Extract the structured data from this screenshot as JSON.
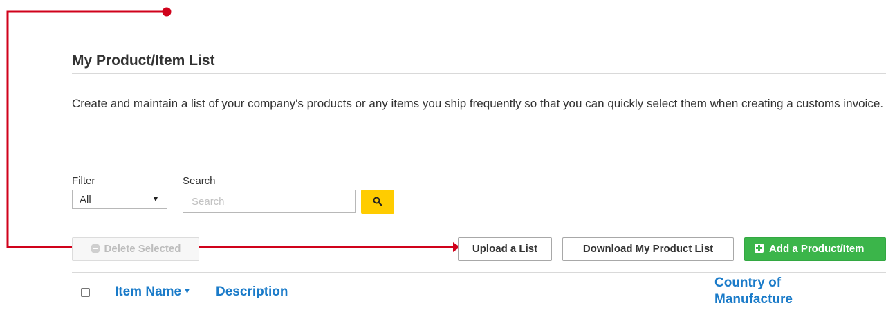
{
  "page": {
    "title": "My Product/Item List",
    "description": "Create and maintain a list of your company's products or any items you ship frequently so that you can quickly select them when creating a customs invoice."
  },
  "filter": {
    "label": "Filter",
    "selected": "All"
  },
  "search": {
    "label": "Search",
    "placeholder": "Search",
    "button_icon": "search-icon"
  },
  "actions": {
    "delete_selected": "Delete Selected",
    "upload_list": "Upload a List",
    "download_list": "Download My Product List",
    "add_product": "Add a Product/Item"
  },
  "table": {
    "columns": {
      "item_name": "Item Name",
      "description": "Description",
      "country_line1": "Country of",
      "country_line2": "Manufacture"
    }
  },
  "colors": {
    "annotation": "#d0021b",
    "search_button": "#ffcc00",
    "add_button": "#3bb54a",
    "link": "#1a7bc9"
  }
}
